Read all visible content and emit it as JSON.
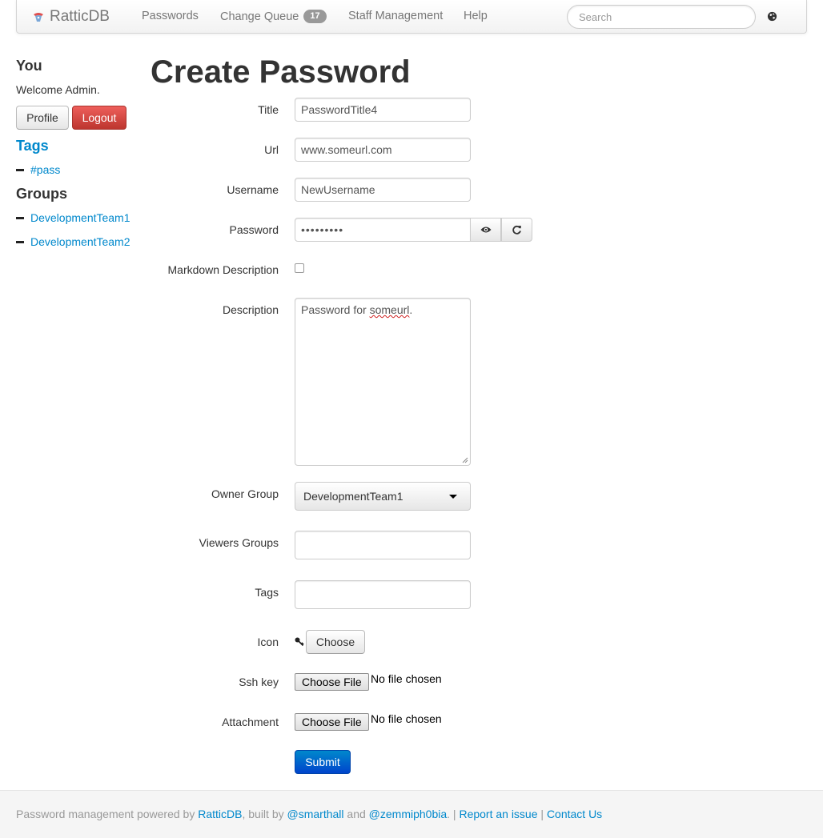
{
  "navbar": {
    "brand": "RatticDB",
    "items": {
      "passwords": "Passwords",
      "change_queue": "Change Queue",
      "change_queue_count": "17",
      "staff_management": "Staff Management",
      "help": "Help"
    },
    "search_placeholder": "Search"
  },
  "sidebar": {
    "you_heading": "You",
    "welcome": "Welcome Admin.",
    "profile_button": "Profile",
    "logout_button": "Logout",
    "tags_heading": "Tags",
    "tags": [
      "#pass"
    ],
    "groups_heading": "Groups",
    "groups": [
      "DevelopmentTeam1",
      "DevelopmentTeam2"
    ]
  },
  "form": {
    "page_title": "Create Password",
    "title_label": "Title",
    "title_value": "PasswordTitle4",
    "url_label": "Url",
    "url_value": "www.someurl.com",
    "username_label": "Username",
    "username_value": "NewUsername",
    "password_label": "Password",
    "password_mask": "•••••••••",
    "markdown_label": "Markdown Description",
    "markdown_checked": false,
    "description_label": "Description",
    "description_prefix": "Password for ",
    "description_spell": "someurl",
    "description_suffix": ".",
    "owner_group_label": "Owner Group",
    "owner_group_value": "DevelopmentTeam1",
    "viewers_groups_label": "Viewers Groups",
    "tags_label": "Tags",
    "icon_label": "Icon",
    "icon_choose_button": "Choose",
    "ssh_key_label": "Ssh key",
    "attachment_label": "Attachment",
    "choose_file_button": "Choose File",
    "no_file_text": "No file chosen",
    "submit_button": "Submit"
  },
  "footer": {
    "text1": "Password management powered by ",
    "ratticdb_link": "RatticDB",
    "text2": ", built by ",
    "smarthall_link": "@smarthall",
    "text3": " and ",
    "zemmiph0bia_link": "@zemmiph0bia",
    "text4": ". | ",
    "report_link": "Report an issue",
    "text5": " | ",
    "contact_link": "Contact Us"
  },
  "colors": {
    "link": "#0088cc",
    "danger": "#da4f49",
    "primary": "#0055cc",
    "badge": "#999999"
  }
}
